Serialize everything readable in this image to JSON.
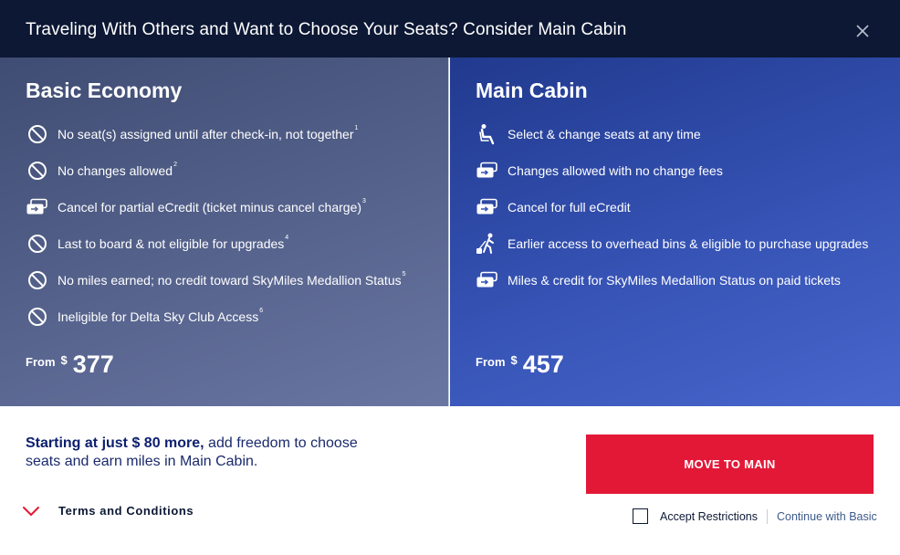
{
  "modal": {
    "title": "Traveling With Others and Want to Choose Your Seats? Consider Main Cabin",
    "close_icon": "close-icon"
  },
  "basic_economy": {
    "title": "Basic Economy",
    "features": [
      {
        "icon": "no-icon",
        "text": "No seat(s) assigned until after check-in, not together",
        "note": "1"
      },
      {
        "icon": "no-icon",
        "text": "No changes allowed",
        "note": "2"
      },
      {
        "icon": "ticket-icon",
        "text": "Cancel for partial eCredit (ticket minus cancel charge)",
        "note": "3"
      },
      {
        "icon": "no-icon",
        "text": "Last to board & not eligible for upgrades",
        "note": "4"
      },
      {
        "icon": "no-icon",
        "text": "No miles earned; no credit toward SkyMiles Medallion Status",
        "note": "5"
      },
      {
        "icon": "no-icon",
        "text": "Ineligible for Delta Sky Club Access",
        "note": "6"
      }
    ],
    "price": {
      "from": "From",
      "currency": "$",
      "amount": "377"
    }
  },
  "main_cabin": {
    "title": "Main Cabin",
    "features": [
      {
        "icon": "seat-icon",
        "text": "Select & change seats at any time"
      },
      {
        "icon": "ticket-icon",
        "text": "Changes allowed with no change fees"
      },
      {
        "icon": "ticket-icon",
        "text": "Cancel for full eCredit"
      },
      {
        "icon": "traveler-icon",
        "text": "Earlier access to overhead bins & eligible to purchase upgrades"
      },
      {
        "icon": "ticket-icon",
        "text": "Miles & credit for SkyMiles Medallion Status on paid tickets"
      }
    ],
    "price": {
      "from": "From",
      "currency": "$",
      "amount": "457"
    }
  },
  "footer": {
    "promo_bold": "Starting at just $ 80 more,",
    "promo_rest": " add freedom to choose seats and earn miles in Main Cabin.",
    "terms_label": "Terms and Conditions",
    "move_button": "MOVE TO MAIN",
    "accept_label": "Accept Restrictions",
    "continue_label": "Continue with Basic"
  },
  "colors": {
    "header_bg": "#0c1834",
    "basic_bg": "#56638d",
    "main_bg": "#3653b5",
    "accent_red": "#e31837",
    "text_navy": "#0c1f6e"
  }
}
